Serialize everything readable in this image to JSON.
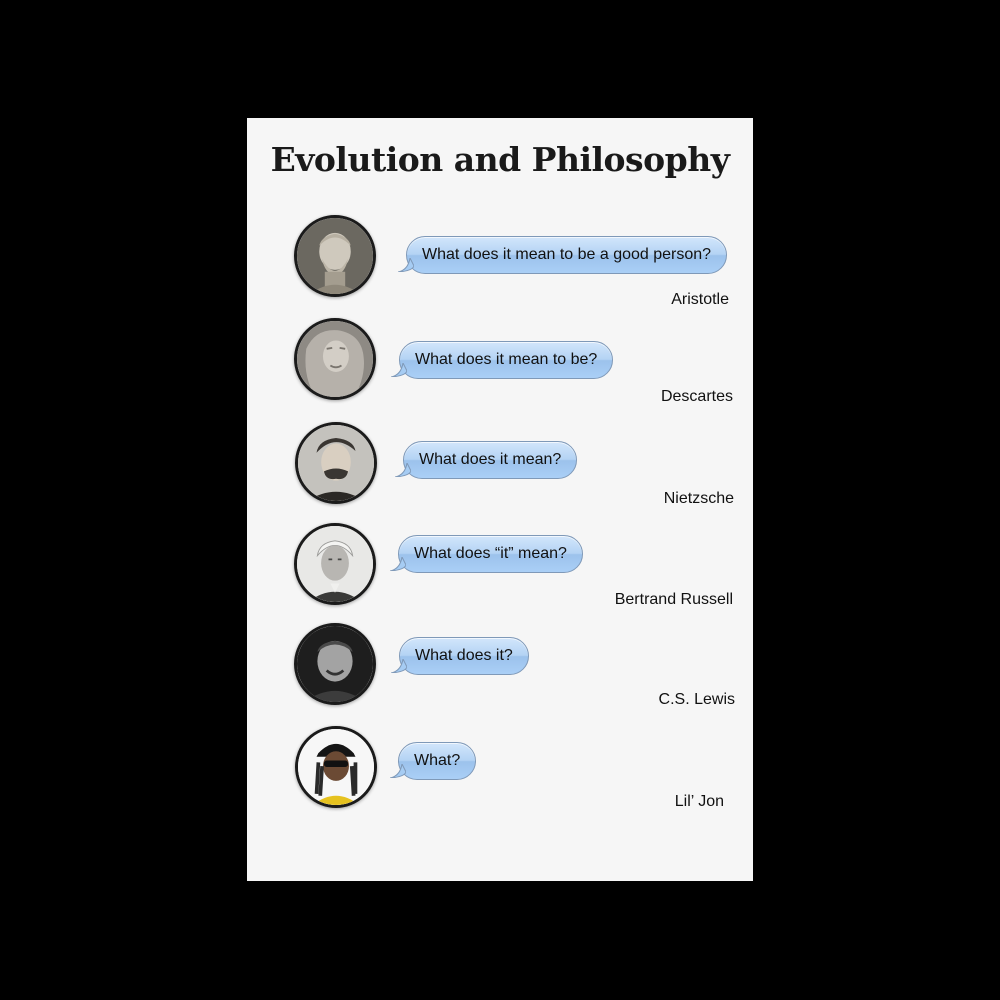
{
  "title": "Evolution and Philosophy",
  "rows": [
    {
      "quote": "What does it mean to be a good person?",
      "name": "Aristotle",
      "portrait": "aristotle-bust-portrait"
    },
    {
      "quote": "What does it mean to be?",
      "name": "Descartes",
      "portrait": "descartes-statue-portrait"
    },
    {
      "quote": "What does it mean?",
      "name": "Nietzsche",
      "portrait": "nietzsche-portrait"
    },
    {
      "quote": "What does “it” mean?",
      "name": "Bertrand Russell",
      "portrait": "bertrand-russell-portrait"
    },
    {
      "quote": "What does it?",
      "name": "C.S. Lewis",
      "portrait": "cs-lewis-portrait"
    },
    {
      "quote": "What?",
      "name": "Lil’ Jon",
      "portrait": "lil-jon-portrait"
    }
  ],
  "colors": {
    "background": "#000000",
    "card": "#f6f6f6",
    "bubble_top": "#d2e6fb",
    "bubble_bottom": "#9cc2ec",
    "bubble_border": "#7f99b8"
  }
}
